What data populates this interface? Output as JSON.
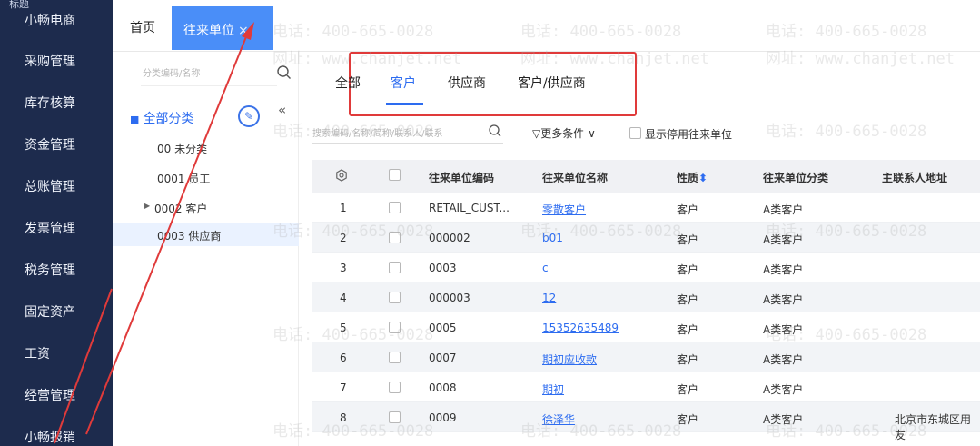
{
  "nav": {
    "top": "标题",
    "items": [
      "小畅电商",
      "采购管理",
      "库存核算",
      "资金管理",
      "总账管理",
      "发票管理",
      "税务管理",
      "固定资产",
      "工资",
      "经营管理",
      "小畅报销"
    ]
  },
  "tabs": {
    "home": "首页",
    "active": "往来单位",
    "close": "×"
  },
  "category": {
    "search_placeholder": "分类编码/名称",
    "all_label": "全部分类",
    "items": [
      "00 未分类",
      "0001 员工",
      "0002 客户",
      "0003 供应商"
    ],
    "selected_index": 3
  },
  "subtabs": {
    "items": [
      "全部",
      "客户",
      "供应商",
      "客户/供应商"
    ],
    "active_index": 1
  },
  "filter": {
    "search_placeholder": "搜索编码/名称/简称/联系人/联系",
    "more_label": "更多条件",
    "show_disabled_label": "显示停用往来单位"
  },
  "table": {
    "headers": [
      "往来单位编码",
      "往来单位名称",
      "性质",
      "往来单位分类",
      "主联系人地址"
    ],
    "rows": [
      {
        "no": "1",
        "code": "RETAIL_CUST...",
        "name": "零散客户",
        "type": "客户",
        "cat": "A类客户",
        "addr": ""
      },
      {
        "no": "2",
        "code": "000002",
        "name": "b01",
        "type": "客户",
        "cat": "A类客户",
        "addr": ""
      },
      {
        "no": "3",
        "code": "0003",
        "name": "c",
        "type": "客户",
        "cat": "A类客户",
        "addr": ""
      },
      {
        "no": "4",
        "code": "000003",
        "name": "12",
        "type": "客户",
        "cat": "A类客户",
        "addr": ""
      },
      {
        "no": "5",
        "code": "0005",
        "name": "15352635489",
        "type": "客户",
        "cat": "A类客户",
        "addr": ""
      },
      {
        "no": "6",
        "code": "0007",
        "name": "期初应收款",
        "type": "客户",
        "cat": "A类客户",
        "addr": ""
      },
      {
        "no": "7",
        "code": "0008",
        "name": "期初",
        "type": "客户",
        "cat": "A类客户",
        "addr": ""
      },
      {
        "no": "8",
        "code": "0009",
        "name": "徐泽华",
        "type": "客户",
        "cat": "A类客户",
        "addr": "北京市东城区用友"
      }
    ]
  },
  "watermark": {
    "phone": "电话: 400-665-0028",
    "site": "网址: www.chanjet.net"
  },
  "colors": {
    "nav_bg": "#1d2b4d",
    "accent": "#2d6cf0",
    "tab_active": "#4a8ef8",
    "annotation": "#e03a3a"
  }
}
